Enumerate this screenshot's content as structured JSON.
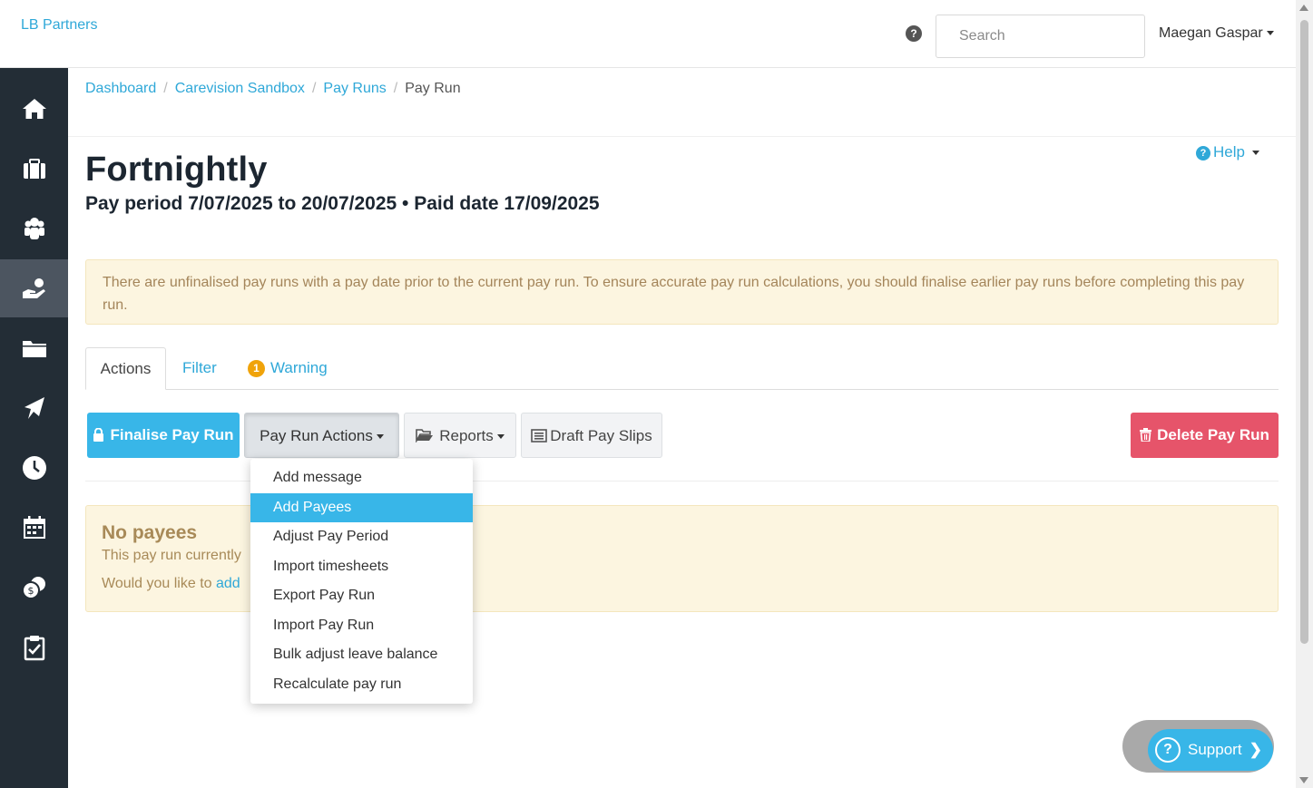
{
  "brand": "LB Partners",
  "header": {
    "help_icon": "question-circle-icon",
    "search_placeholder": "Search",
    "user_name": "Maegan Gaspar"
  },
  "sidebar": {
    "items": [
      {
        "icon": "home-icon"
      },
      {
        "icon": "briefcase-icon"
      },
      {
        "icon": "users-icon"
      },
      {
        "icon": "hand-payment-icon",
        "active": true
      },
      {
        "icon": "folder-icon"
      },
      {
        "icon": "plane-icon"
      },
      {
        "icon": "clock-icon"
      },
      {
        "icon": "calendar-icon"
      },
      {
        "icon": "coins-icon"
      },
      {
        "icon": "clipboard-check-icon"
      }
    ]
  },
  "breadcrumb": {
    "items": [
      "Dashboard",
      "Carevision Sandbox",
      "Pay Runs"
    ],
    "current": "Pay Run"
  },
  "help": {
    "label": "Help"
  },
  "page": {
    "title": "Fortnightly",
    "subtitle": "Pay period 7/07/2025 to 20/07/2025 • Paid date 17/09/2025"
  },
  "alert": {
    "text": "There are unfinalised pay runs with a pay date prior to the current pay run. To ensure accurate pay run calculations, you should finalise earlier pay runs before completing this pay run."
  },
  "tabs": {
    "actions": "Actions",
    "filter": "Filter",
    "warning": "Warning",
    "warning_count": "1"
  },
  "toolbar": {
    "finalise": "Finalise Pay Run",
    "pay_run_actions": "Pay Run Actions",
    "reports": "Reports",
    "draft_pay_slips": "Draft Pay Slips",
    "delete": "Delete Pay Run"
  },
  "dropdown": {
    "items": [
      "Add message",
      "Add Payees",
      "Adjust Pay Period",
      "Import timesheets",
      "Export Pay Run",
      "Import Pay Run",
      "Bulk adjust leave balance",
      "Recalculate pay run"
    ],
    "highlighted": "Add Payees"
  },
  "no_payees": {
    "title": "No payees",
    "line1": "This pay run currently",
    "line2_prefix": "Would you like to ",
    "line2_link": "add"
  },
  "support": {
    "label": "Support"
  },
  "colors": {
    "accent": "#38b6e8",
    "link": "#2fa8d8",
    "danger": "#e6546a",
    "sidebar": "#232d36",
    "alert_bg": "#fcf5e0",
    "badge": "#f0a30a"
  }
}
